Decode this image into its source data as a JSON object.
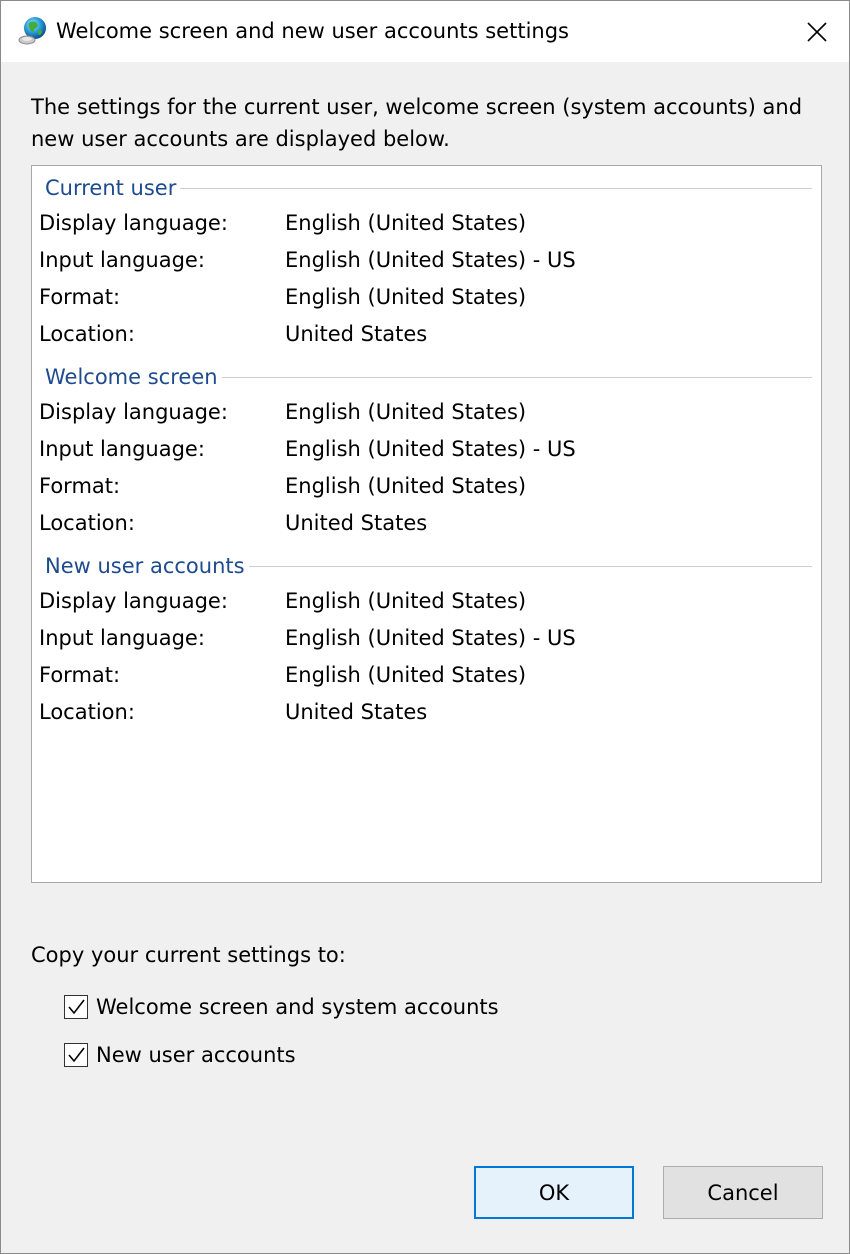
{
  "window": {
    "title": "Welcome screen and new user accounts settings",
    "title_icon": "globe-icon",
    "close_icon": "close-icon"
  },
  "description": "The settings for the current user, welcome screen (system accounts) and new user accounts are displayed below.",
  "groups": [
    {
      "title": "Current user",
      "rows": [
        {
          "label": "Display language:",
          "value": "English (United States)"
        },
        {
          "label": "Input language:",
          "value": "English (United States) - US"
        },
        {
          "label": "Format:",
          "value": "English (United States)"
        },
        {
          "label": "Location:",
          "value": "United States"
        }
      ]
    },
    {
      "title": "Welcome screen",
      "rows": [
        {
          "label": "Display language:",
          "value": "English (United States)"
        },
        {
          "label": "Input language:",
          "value": "English (United States) - US"
        },
        {
          "label": "Format:",
          "value": "English (United States)"
        },
        {
          "label": "Location:",
          "value": "United States"
        }
      ]
    },
    {
      "title": "New user accounts",
      "rows": [
        {
          "label": "Display language:",
          "value": "English (United States)"
        },
        {
          "label": "Input language:",
          "value": "English (United States) - US"
        },
        {
          "label": "Format:",
          "value": "English (United States)"
        },
        {
          "label": "Location:",
          "value": "United States"
        }
      ]
    }
  ],
  "copy": {
    "label": "Copy your current settings to:",
    "options": [
      {
        "label": "Welcome screen and system accounts",
        "checked": true
      },
      {
        "label": "New user accounts",
        "checked": true
      }
    ]
  },
  "buttons": {
    "ok": "OK",
    "cancel": "Cancel"
  },
  "colors": {
    "group_title": "#1e4a8e",
    "default_button_border": "#0078d7"
  }
}
